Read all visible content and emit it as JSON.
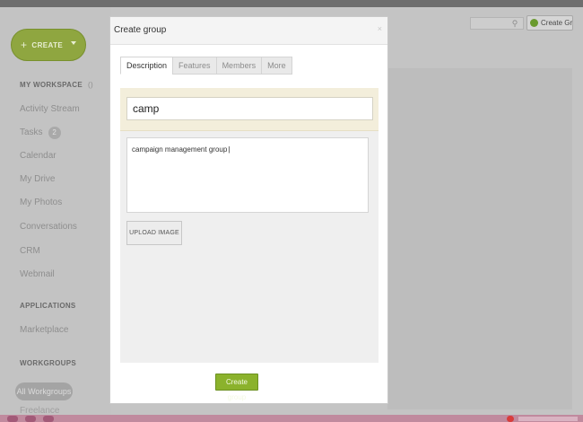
{
  "sidebar": {
    "create_label": "CREATE",
    "my_workspace": {
      "label": "MY WORKSPACE",
      "suffix": "()"
    },
    "items": [
      {
        "label": "Activity Stream"
      },
      {
        "label": "Tasks",
        "badge": "2"
      },
      {
        "label": "Calendar"
      },
      {
        "label": "My Drive"
      },
      {
        "label": "My Photos"
      },
      {
        "label": "Conversations"
      },
      {
        "label": "CRM"
      },
      {
        "label": "Webmail"
      }
    ],
    "applications": {
      "label": "APPLICATIONS",
      "items": [
        {
          "label": "Marketplace"
        }
      ]
    },
    "workgroups": {
      "label": "WORKGROUPS",
      "pill": "All Workgroups",
      "items": [
        {
          "label": "Freelance"
        }
      ]
    }
  },
  "topbar": {
    "create_group_label": "Create Group"
  },
  "modal": {
    "title": "Create group",
    "close_glyph": "×",
    "tabs": [
      {
        "label": "Description",
        "active": true
      },
      {
        "label": "Features",
        "active": false
      },
      {
        "label": "Members",
        "active": false
      },
      {
        "label": "More",
        "active": false
      }
    ],
    "group_name_value": "camp",
    "description_value": "campaign management group",
    "upload_label": "UPLOAD IMAGE",
    "submit_label": "Create group"
  },
  "colors": {
    "accent_green": "#8bb22c",
    "title_area_bg": "#f3eedb",
    "overlay_gray": "#c4c4c4"
  }
}
